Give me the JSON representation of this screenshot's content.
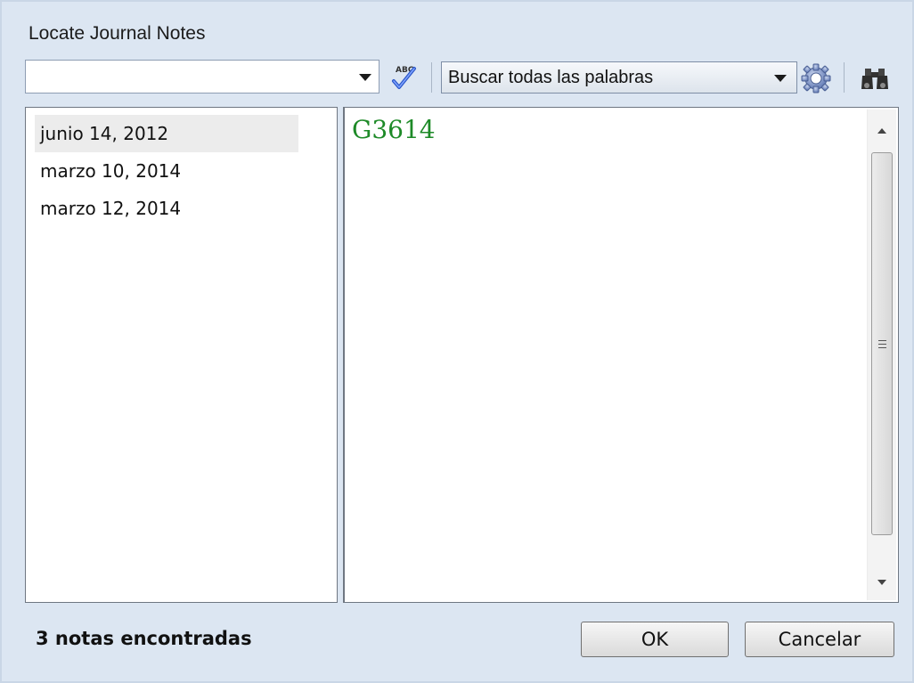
{
  "window": {
    "title": "Locate Journal Notes"
  },
  "toolbar": {
    "search_value": "",
    "spell_icon": "spell-check-icon",
    "search_mode": "Buscar todas las palabras",
    "gear_icon": "gear-icon",
    "find_icon": "binoculars-icon"
  },
  "results": {
    "items": [
      {
        "label": "junio 14, 2012",
        "selected": true
      },
      {
        "label": "marzo 10, 2014",
        "selected": false
      },
      {
        "label": "marzo 12, 2014",
        "selected": false
      }
    ]
  },
  "preview": {
    "text": "G3614",
    "text_color": "#1e8a28"
  },
  "footer": {
    "status": "3 notas encontradas",
    "ok_label": "OK",
    "cancel_label": "Cancelar"
  }
}
